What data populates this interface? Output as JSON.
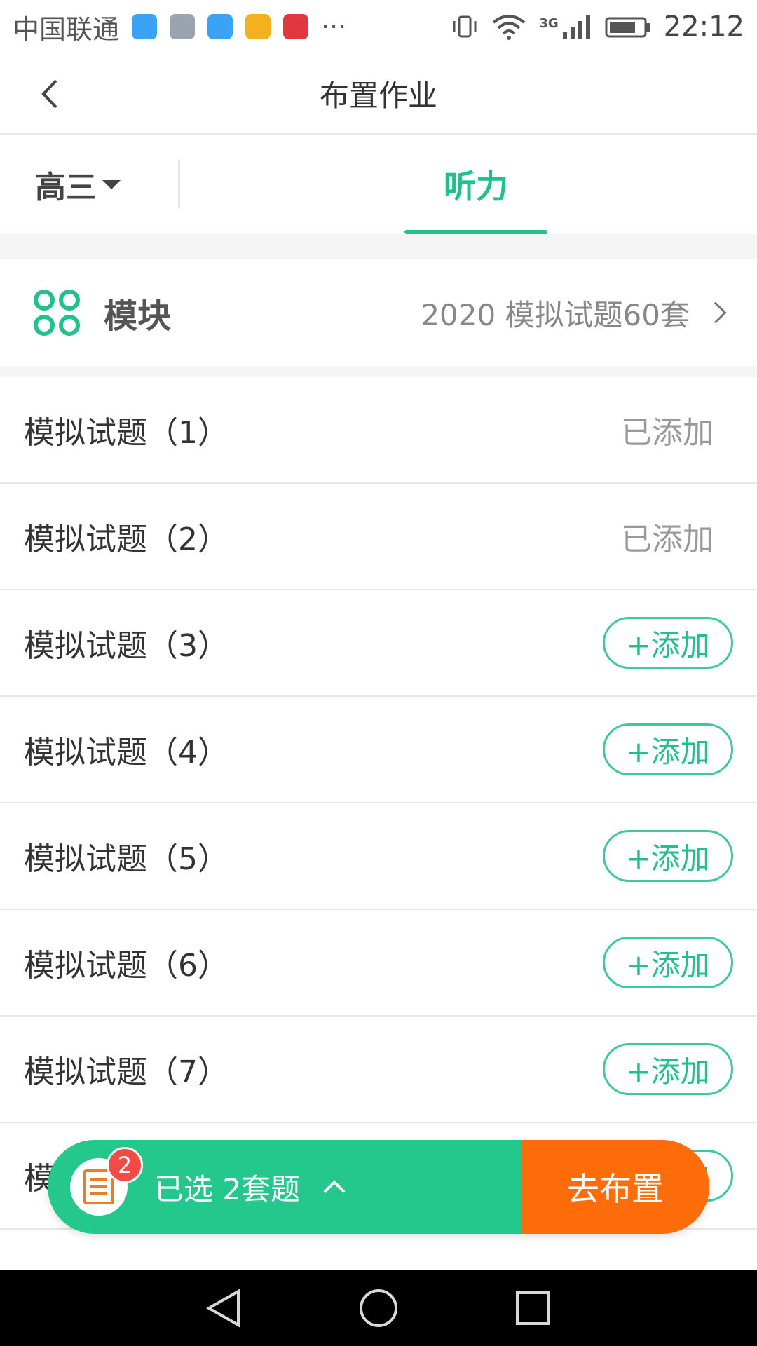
{
  "status_bar": {
    "carrier": "中国联通",
    "more": "···",
    "network": "3G",
    "time": "22:12",
    "app_icon_colors": [
      "#3aa3f5",
      "#9aa4b0",
      "#3aa3f5",
      "#f5b020",
      "#e0383e"
    ]
  },
  "header": {
    "title": "布置作业"
  },
  "filter": {
    "grade": "高三",
    "tab": "听力"
  },
  "module": {
    "label": "模块",
    "value": "2020 模拟试题60套"
  },
  "list": {
    "added_label": "已添加",
    "add_label": "+添加",
    "items": [
      {
        "title": "模拟试题（1）"
      },
      {
        "title": "模拟试题（2）"
      },
      {
        "title": "模拟试题（3）"
      },
      {
        "title": "模拟试题（4）"
      },
      {
        "title": "模拟试题（5）"
      },
      {
        "title": "模拟试题（6）"
      },
      {
        "title": "模拟试题（7）"
      },
      {
        "title": "模拟试题（8）"
      }
    ]
  },
  "bottom_bar": {
    "badge_count": "2",
    "selected_text": "已选 2套题",
    "assign_label": "去布置"
  },
  "colors": {
    "accent_green": "#22c08a",
    "assign_orange": "#ff6d0a",
    "badge_red": "#f24b46"
  }
}
